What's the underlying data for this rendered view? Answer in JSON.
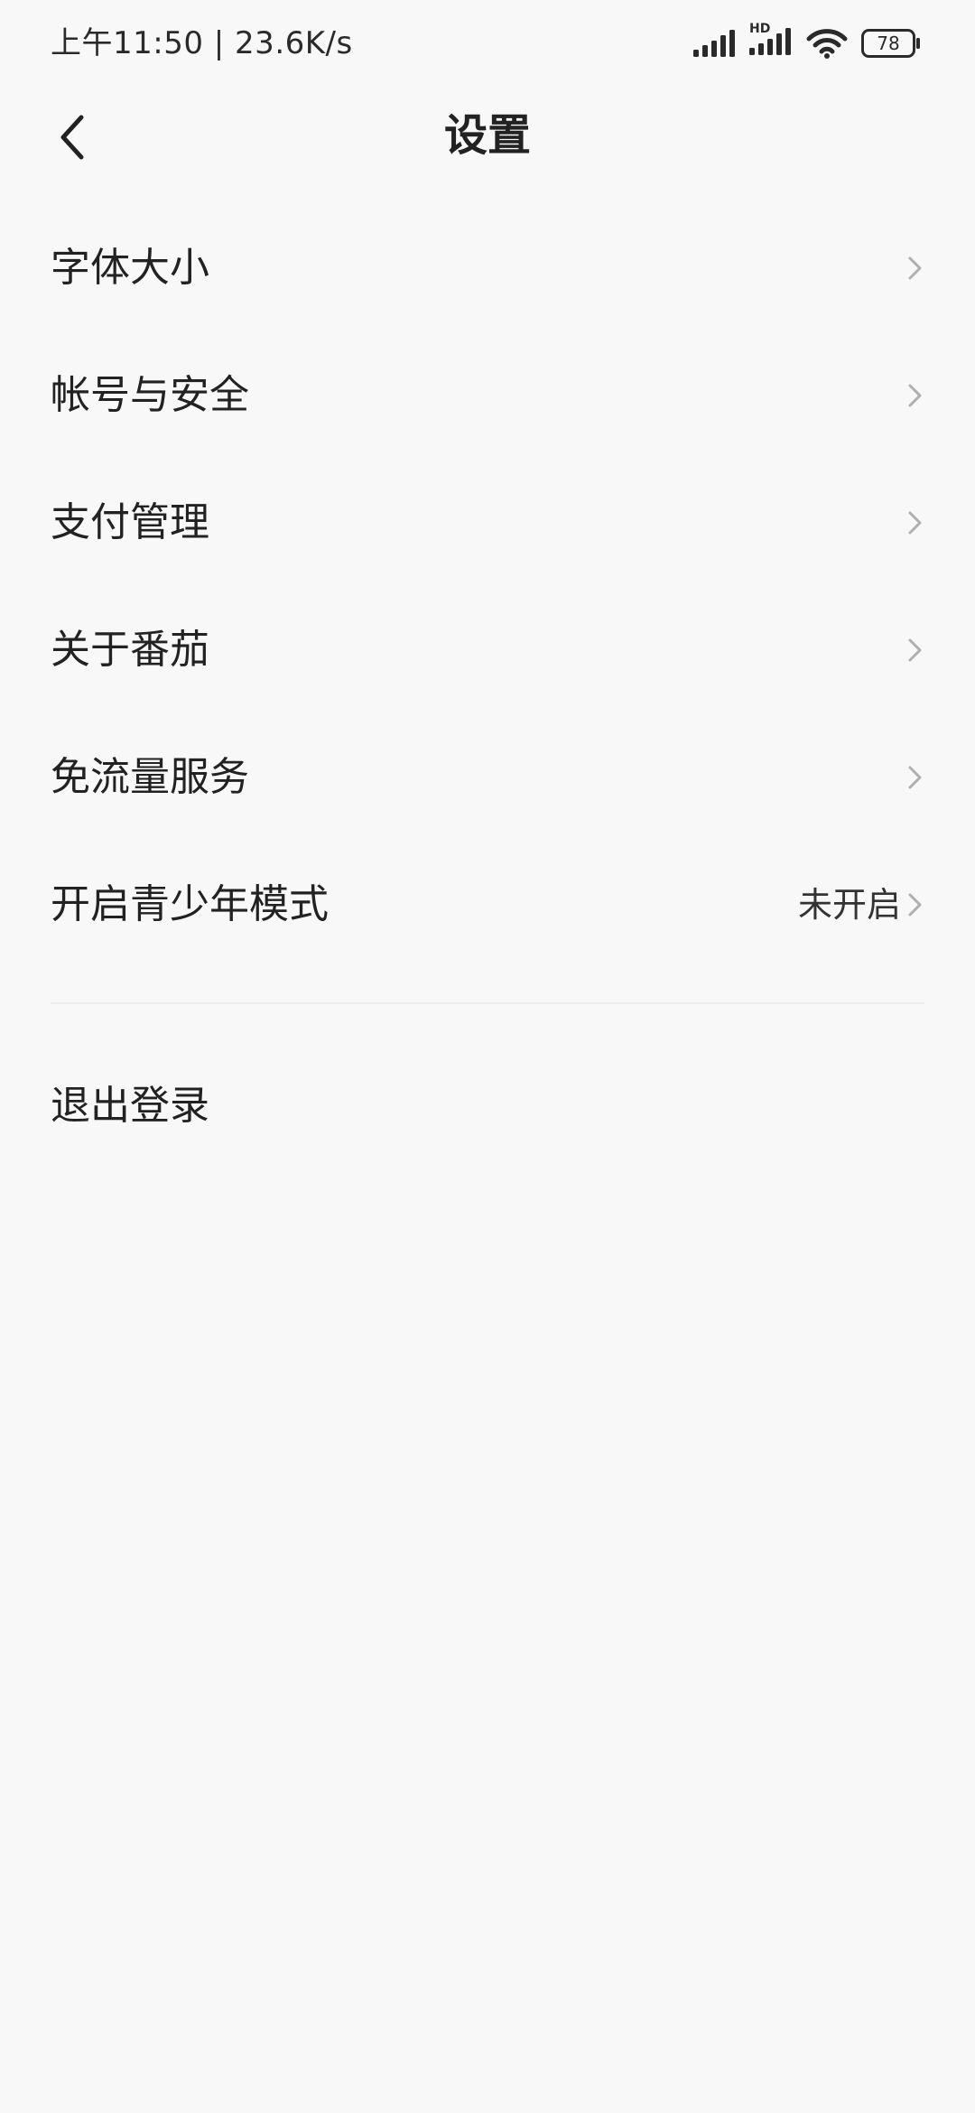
{
  "status_bar": {
    "time_speed": "上午11:50 | 23.6K/s",
    "hd_label": "HD",
    "battery_level": "78",
    "icons": [
      "signal-icon",
      "hd-signal-icon",
      "wifi-icon",
      "battery-icon"
    ]
  },
  "header": {
    "back_icon": "chevron-left-icon",
    "title": "设置"
  },
  "menu": {
    "items": [
      {
        "label": "字体大小",
        "value": ""
      },
      {
        "label": "帐号与安全",
        "value": ""
      },
      {
        "label": "支付管理",
        "value": ""
      },
      {
        "label": "关于番茄",
        "value": ""
      },
      {
        "label": "免流量服务",
        "value": ""
      },
      {
        "label": "开启青少年模式",
        "value": "未开启"
      }
    ]
  },
  "logout": {
    "label": "退出登录"
  },
  "colors": {
    "background": "#f8f8f8",
    "text": "#222222",
    "chevron": "#b0b0b0",
    "divider": "#ececec"
  }
}
